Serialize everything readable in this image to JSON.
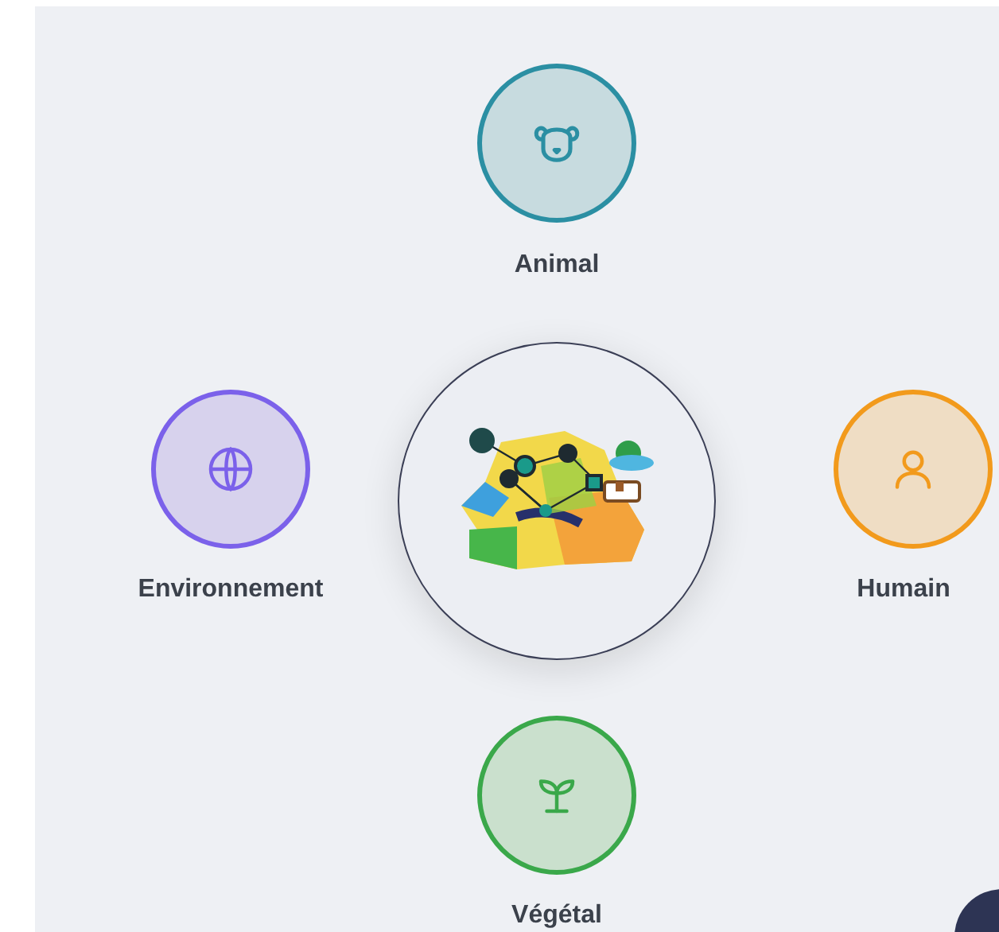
{
  "domains": [
    {
      "kind": "animal",
      "label": "Animal",
      "color": "#2b8fa3"
    },
    {
      "kind": "environment",
      "label": "Environnement",
      "color": "#7b61ea"
    },
    {
      "kind": "human",
      "label": "Humain",
      "color": "#f29a1c"
    },
    {
      "kind": "plant",
      "label": "Végétal",
      "color": "#3aa84a"
    }
  ]
}
